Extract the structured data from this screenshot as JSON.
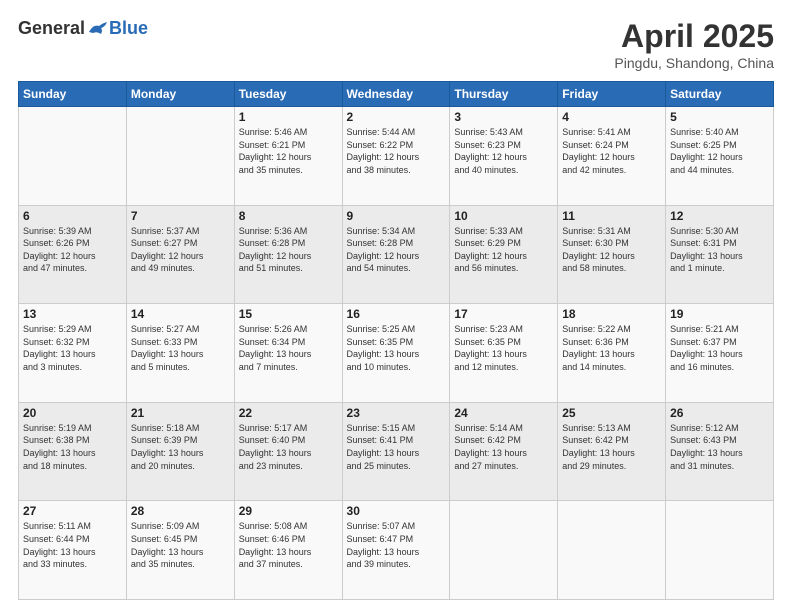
{
  "logo": {
    "general": "General",
    "blue": "Blue"
  },
  "header": {
    "title": "April 2025",
    "location": "Pingdu, Shandong, China"
  },
  "days_of_week": [
    "Sunday",
    "Monday",
    "Tuesday",
    "Wednesday",
    "Thursday",
    "Friday",
    "Saturday"
  ],
  "weeks": [
    [
      {
        "day": "",
        "info": ""
      },
      {
        "day": "",
        "info": ""
      },
      {
        "day": "1",
        "info": "Sunrise: 5:46 AM\nSunset: 6:21 PM\nDaylight: 12 hours\nand 35 minutes."
      },
      {
        "day": "2",
        "info": "Sunrise: 5:44 AM\nSunset: 6:22 PM\nDaylight: 12 hours\nand 38 minutes."
      },
      {
        "day": "3",
        "info": "Sunrise: 5:43 AM\nSunset: 6:23 PM\nDaylight: 12 hours\nand 40 minutes."
      },
      {
        "day": "4",
        "info": "Sunrise: 5:41 AM\nSunset: 6:24 PM\nDaylight: 12 hours\nand 42 minutes."
      },
      {
        "day": "5",
        "info": "Sunrise: 5:40 AM\nSunset: 6:25 PM\nDaylight: 12 hours\nand 44 minutes."
      }
    ],
    [
      {
        "day": "6",
        "info": "Sunrise: 5:39 AM\nSunset: 6:26 PM\nDaylight: 12 hours\nand 47 minutes."
      },
      {
        "day": "7",
        "info": "Sunrise: 5:37 AM\nSunset: 6:27 PM\nDaylight: 12 hours\nand 49 minutes."
      },
      {
        "day": "8",
        "info": "Sunrise: 5:36 AM\nSunset: 6:28 PM\nDaylight: 12 hours\nand 51 minutes."
      },
      {
        "day": "9",
        "info": "Sunrise: 5:34 AM\nSunset: 6:28 PM\nDaylight: 12 hours\nand 54 minutes."
      },
      {
        "day": "10",
        "info": "Sunrise: 5:33 AM\nSunset: 6:29 PM\nDaylight: 12 hours\nand 56 minutes."
      },
      {
        "day": "11",
        "info": "Sunrise: 5:31 AM\nSunset: 6:30 PM\nDaylight: 12 hours\nand 58 minutes."
      },
      {
        "day": "12",
        "info": "Sunrise: 5:30 AM\nSunset: 6:31 PM\nDaylight: 13 hours\nand 1 minute."
      }
    ],
    [
      {
        "day": "13",
        "info": "Sunrise: 5:29 AM\nSunset: 6:32 PM\nDaylight: 13 hours\nand 3 minutes."
      },
      {
        "day": "14",
        "info": "Sunrise: 5:27 AM\nSunset: 6:33 PM\nDaylight: 13 hours\nand 5 minutes."
      },
      {
        "day": "15",
        "info": "Sunrise: 5:26 AM\nSunset: 6:34 PM\nDaylight: 13 hours\nand 7 minutes."
      },
      {
        "day": "16",
        "info": "Sunrise: 5:25 AM\nSunset: 6:35 PM\nDaylight: 13 hours\nand 10 minutes."
      },
      {
        "day": "17",
        "info": "Sunrise: 5:23 AM\nSunset: 6:35 PM\nDaylight: 13 hours\nand 12 minutes."
      },
      {
        "day": "18",
        "info": "Sunrise: 5:22 AM\nSunset: 6:36 PM\nDaylight: 13 hours\nand 14 minutes."
      },
      {
        "day": "19",
        "info": "Sunrise: 5:21 AM\nSunset: 6:37 PM\nDaylight: 13 hours\nand 16 minutes."
      }
    ],
    [
      {
        "day": "20",
        "info": "Sunrise: 5:19 AM\nSunset: 6:38 PM\nDaylight: 13 hours\nand 18 minutes."
      },
      {
        "day": "21",
        "info": "Sunrise: 5:18 AM\nSunset: 6:39 PM\nDaylight: 13 hours\nand 20 minutes."
      },
      {
        "day": "22",
        "info": "Sunrise: 5:17 AM\nSunset: 6:40 PM\nDaylight: 13 hours\nand 23 minutes."
      },
      {
        "day": "23",
        "info": "Sunrise: 5:15 AM\nSunset: 6:41 PM\nDaylight: 13 hours\nand 25 minutes."
      },
      {
        "day": "24",
        "info": "Sunrise: 5:14 AM\nSunset: 6:42 PM\nDaylight: 13 hours\nand 27 minutes."
      },
      {
        "day": "25",
        "info": "Sunrise: 5:13 AM\nSunset: 6:42 PM\nDaylight: 13 hours\nand 29 minutes."
      },
      {
        "day": "26",
        "info": "Sunrise: 5:12 AM\nSunset: 6:43 PM\nDaylight: 13 hours\nand 31 minutes."
      }
    ],
    [
      {
        "day": "27",
        "info": "Sunrise: 5:11 AM\nSunset: 6:44 PM\nDaylight: 13 hours\nand 33 minutes."
      },
      {
        "day": "28",
        "info": "Sunrise: 5:09 AM\nSunset: 6:45 PM\nDaylight: 13 hours\nand 35 minutes."
      },
      {
        "day": "29",
        "info": "Sunrise: 5:08 AM\nSunset: 6:46 PM\nDaylight: 13 hours\nand 37 minutes."
      },
      {
        "day": "30",
        "info": "Sunrise: 5:07 AM\nSunset: 6:47 PM\nDaylight: 13 hours\nand 39 minutes."
      },
      {
        "day": "",
        "info": ""
      },
      {
        "day": "",
        "info": ""
      },
      {
        "day": "",
        "info": ""
      }
    ]
  ]
}
